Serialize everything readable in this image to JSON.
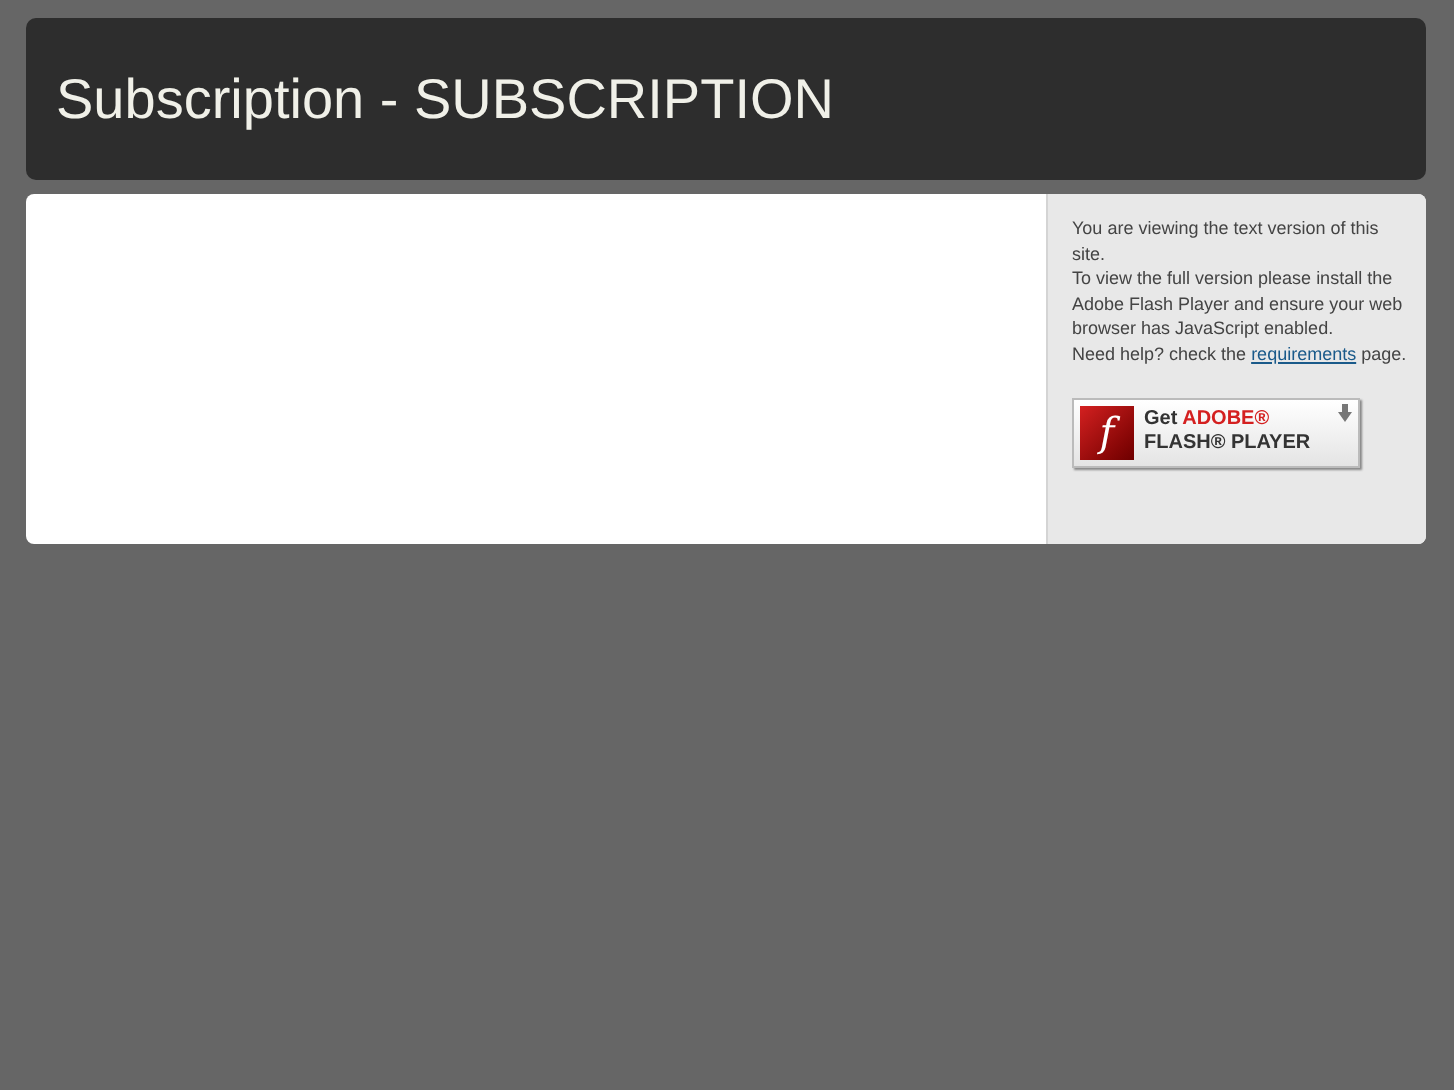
{
  "header": {
    "title": "Subscription - SUBSCRIPTION"
  },
  "sidebar": {
    "lines": [
      "You are viewing the text version of this site.",
      "To view the full version please install the Adobe Flash Player and ensure your web browser has JavaScript enabled."
    ],
    "help": {
      "before": "Need help? check the",
      "link": "requirements",
      "after": "page."
    },
    "badge": {
      "logo_letter": "f",
      "line_1": "Get",
      "brand": "ADOBE®",
      "line_2": "FLASH® PLAYER"
    }
  }
}
